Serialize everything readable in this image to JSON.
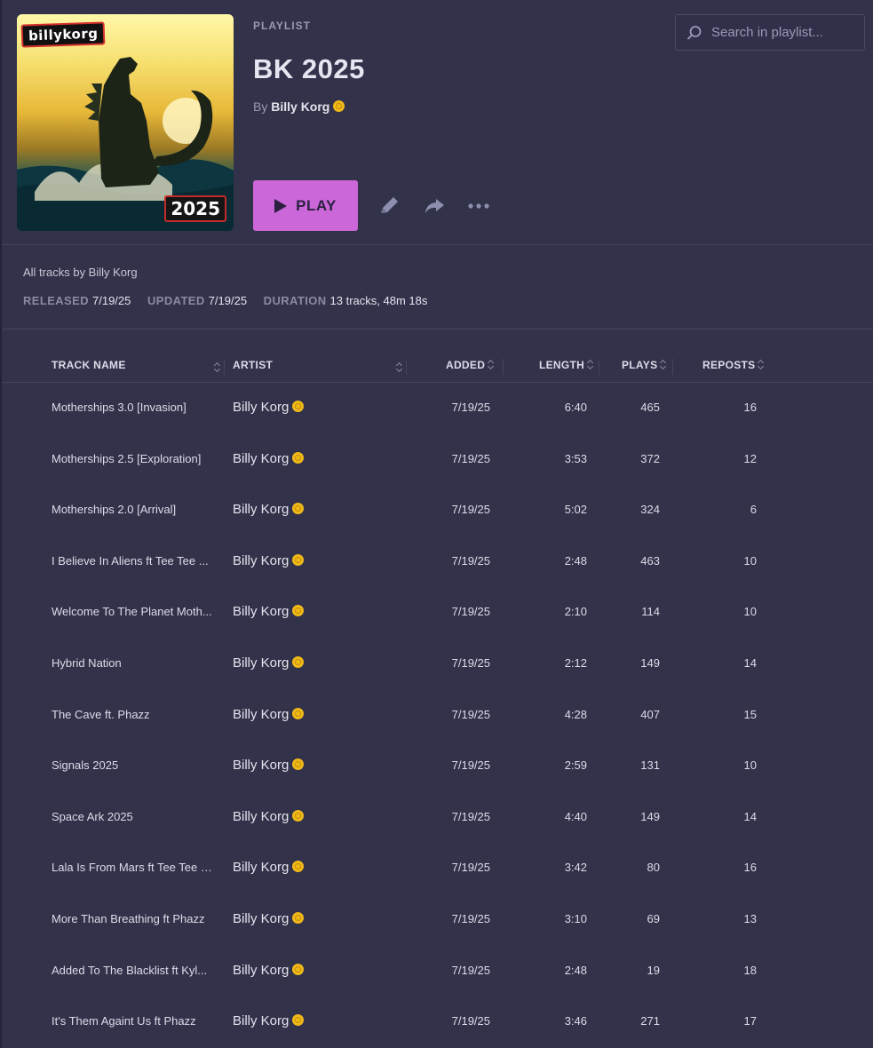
{
  "playlist": {
    "eyebrow": "PLAYLIST",
    "title": "BK 2025",
    "by_prefix": "By",
    "author": "Billy Korg",
    "cover_logo_text": "billykorg",
    "cover_year_text": "2025",
    "play_label": "PLAY",
    "description": "All tracks by Billy Korg"
  },
  "search": {
    "placeholder": "Search in playlist..."
  },
  "meta": {
    "released_label": "RELEASED",
    "released": "7/19/25",
    "updated_label": "UPDATED",
    "updated": "7/19/25",
    "duration_label": "DURATION",
    "duration": "13 tracks, 48m 18s"
  },
  "icons": {
    "edit": "pencil-icon",
    "share": "share-icon",
    "more": "more-icon",
    "search": "search-icon",
    "verified": "verified-badge-icon"
  },
  "colors": {
    "accent": "#cb67d8",
    "background": "#32324a",
    "badge": "#f0b91a"
  },
  "table": {
    "headers": {
      "name": "TRACK NAME",
      "artist": "ARTIST",
      "added": "ADDED",
      "length": "LENGTH",
      "plays": "PLAYS",
      "reposts": "REPOSTS"
    },
    "rows": [
      {
        "name": "Motherships 3.0 [Invasion]",
        "artist": "Billy Korg",
        "added": "7/19/25",
        "length": "6:40",
        "plays": "465",
        "reposts": "16"
      },
      {
        "name": "Motherships 2.5 [Exploration]",
        "artist": "Billy Korg",
        "added": "7/19/25",
        "length": "3:53",
        "plays": "372",
        "reposts": "12"
      },
      {
        "name": "Motherships 2.0 [Arrival]",
        "artist": "Billy Korg",
        "added": "7/19/25",
        "length": "5:02",
        "plays": "324",
        "reposts": "6"
      },
      {
        "name": "I Believe In Aliens ft Tee Tee ...",
        "artist": "Billy Korg",
        "added": "7/19/25",
        "length": "2:48",
        "plays": "463",
        "reposts": "10"
      },
      {
        "name": "Welcome To The Planet Moth...",
        "artist": "Billy Korg",
        "added": "7/19/25",
        "length": "2:10",
        "plays": "114",
        "reposts": "10"
      },
      {
        "name": "Hybrid Nation",
        "artist": "Billy Korg",
        "added": "7/19/25",
        "length": "2:12",
        "plays": "149",
        "reposts": "14"
      },
      {
        "name": "The Cave ft. Phazz",
        "artist": "Billy Korg",
        "added": "7/19/25",
        "length": "4:28",
        "plays": "407",
        "reposts": "15"
      },
      {
        "name": "Signals 2025",
        "artist": "Billy Korg",
        "added": "7/19/25",
        "length": "2:59",
        "plays": "131",
        "reposts": "10"
      },
      {
        "name": "Space Ark 2025",
        "artist": "Billy Korg",
        "added": "7/19/25",
        "length": "4:40",
        "plays": "149",
        "reposts": "14"
      },
      {
        "name": "Lala Is From Mars ft Tee Tee H...",
        "artist": "Billy Korg",
        "added": "7/19/25",
        "length": "3:42",
        "plays": "80",
        "reposts": "16"
      },
      {
        "name": "More Than Breathing ft Phazz",
        "artist": "Billy Korg",
        "added": "7/19/25",
        "length": "3:10",
        "plays": "69",
        "reposts": "13"
      },
      {
        "name": "Added To The Blacklist ft Kyl...",
        "artist": "Billy Korg",
        "added": "7/19/25",
        "length": "2:48",
        "plays": "19",
        "reposts": "18"
      },
      {
        "name": "It's Them Againt Us ft Phazz",
        "artist": "Billy Korg",
        "added": "7/19/25",
        "length": "3:46",
        "plays": "271",
        "reposts": "17"
      }
    ]
  }
}
